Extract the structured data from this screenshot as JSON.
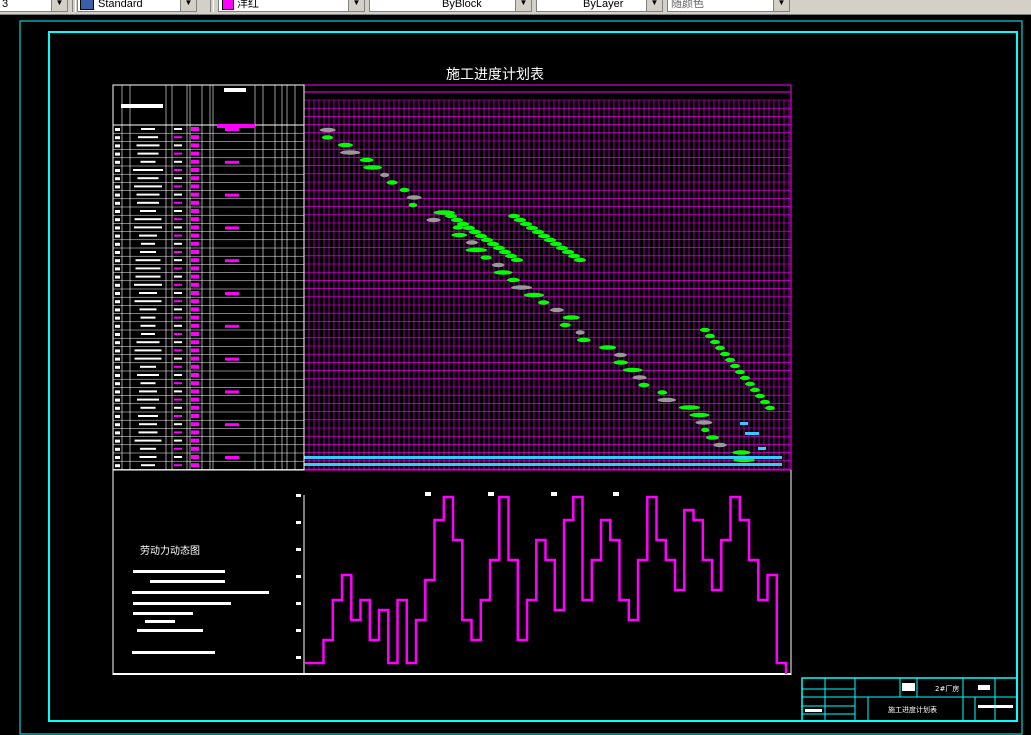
{
  "toolbar": {
    "layer_combo": "3",
    "textstyle_combo": "Standard",
    "color_combo": "洋红",
    "linetype_combo": "ByBlock",
    "lineweight_combo": "ByLayer",
    "plotstyle_combo": "随颜色"
  },
  "drawing": {
    "title": "施工进度计划表",
    "labor_chart_label": "劳动力动态图",
    "title_block": {
      "project_name": "2#厂房",
      "drawing_name": "施工进度计划表"
    }
  },
  "colors": {
    "background": "#000000",
    "border": "#00ffff",
    "grid": "#ff00ff",
    "table_lines": "#ffffff",
    "gantt_bar": "#00ff00",
    "gantt_bar_secondary": "#999999",
    "gantt_bar_cyan": "#33ccff",
    "labor_curve": "#ff00ff"
  }
}
